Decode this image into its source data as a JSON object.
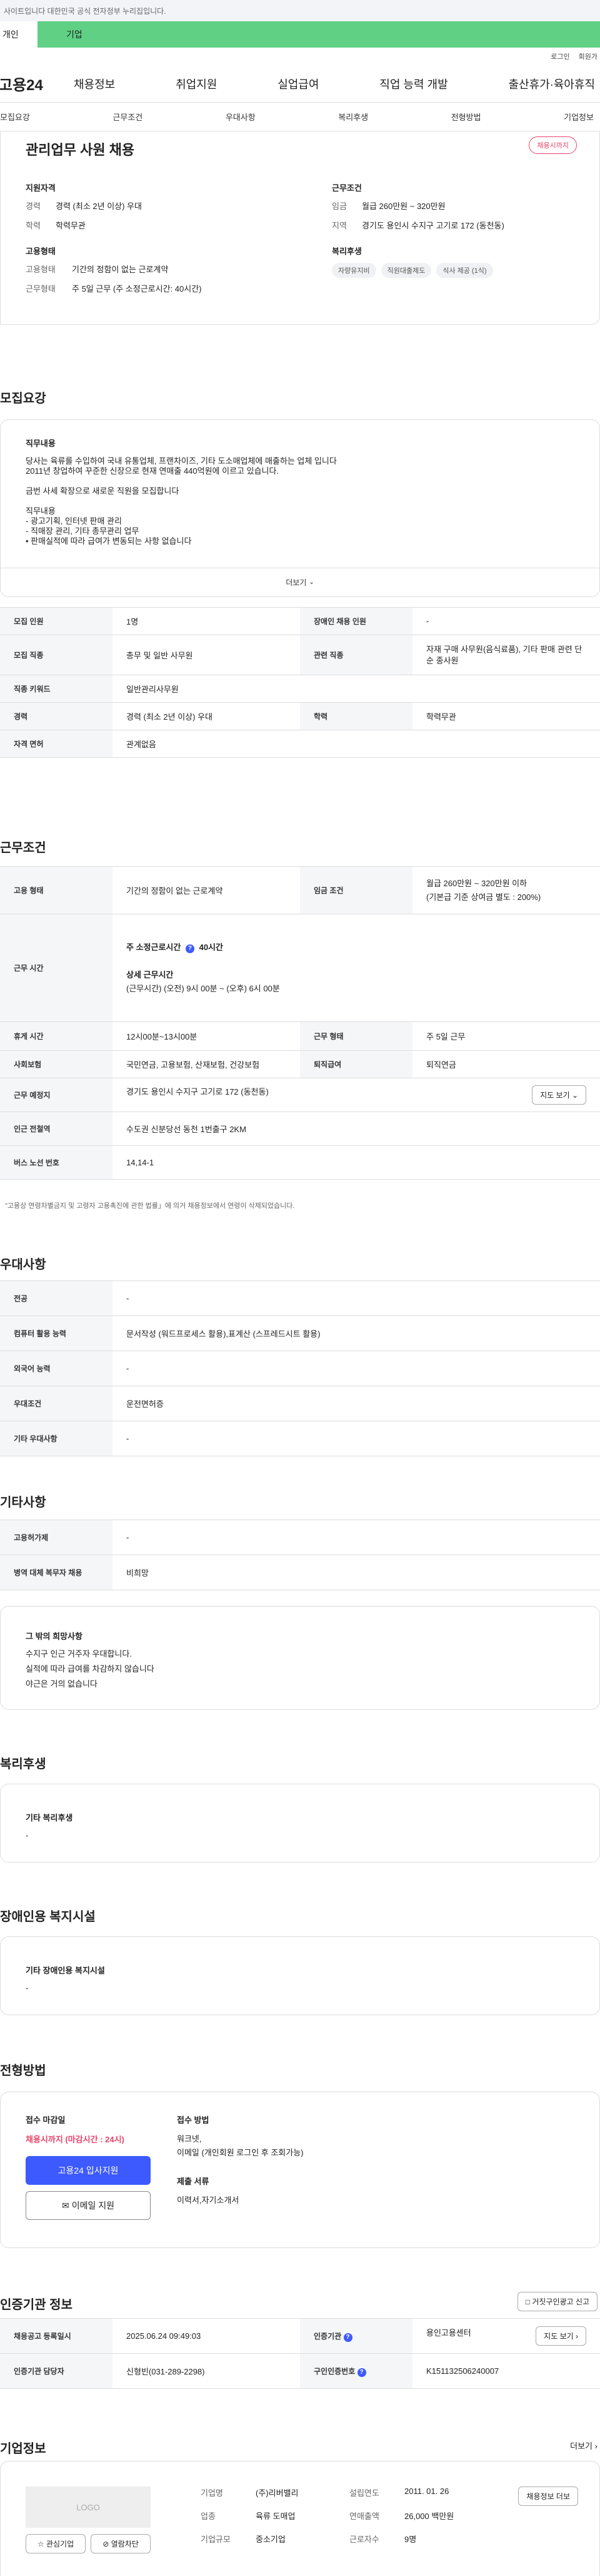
{
  "topstrip": {
    "text": "사이트입니다 대한민국 공식 전자정부 누리집입니다."
  },
  "tabs": {
    "personal": "개인",
    "biz": "기업"
  },
  "util": {
    "login": "로그인",
    "join": "회원가"
  },
  "gnb": {
    "logo": "고용24",
    "menu": [
      "채용정보",
      "취업지원",
      "실업급여",
      "직업 능력 개발",
      "출산휴가·육아휴직"
    ]
  },
  "anchor": [
    "모집요강",
    "근무조건",
    "우대사항",
    "복리후생",
    "전형방법",
    "기업정보"
  ],
  "summary": {
    "title": "관리업무 사원 채용",
    "badge": "채용시까지",
    "qual_h": "지원자격",
    "qual": [
      {
        "k": "경력",
        "v": "경력 (최소 2년 이상) 우대"
      },
      {
        "k": "학력",
        "v": "학력무관"
      }
    ],
    "emp_h": "고용형태",
    "emp": [
      {
        "k": "고용형태",
        "v": "기간의 정함이 없는 근로계약"
      },
      {
        "k": "근무형태",
        "v": "주 5일 근무 (주 소정근로시간: 40시간)"
      }
    ],
    "cond_h": "근무조건",
    "cond": [
      {
        "k": "임금",
        "v": "월급 260만원 ~ 320만원"
      },
      {
        "k": "지역",
        "v": "경기도 용인시 수지구 고기로 172 (동천동)"
      }
    ],
    "welfare_h": "복리후생",
    "chips": [
      "자량유지비",
      "직원대출제도",
      "식사 제공 (1식)"
    ]
  },
  "recruit": {
    "h": "모집요강",
    "duty_h": "직무내용",
    "duty_lines": [
      "당사는 육류를 수입하여 국내 유통업체, 프랜차이즈, 기타 도소매업체에 매출하는 업체 입니다",
      "2011년 창업하여 꾸준한 신장으로 현재 연매출 440억원에 이르고 있습니다.",
      "",
      "금번 사세 확장으로 새로운 직원을 모집합니다",
      "",
      "직무내용",
      "- 광고기획, 인터넷 판매 관리",
      "- 직매장 관리, 기타 총무관리 업무",
      "• 판매실적에 따라 급여가 변동되는 사항 없습니다"
    ],
    "more": "더보기",
    "rows": [
      {
        "k1": "모집 인원",
        "v1": "1명",
        "k2": "장애인 채용 인원",
        "v2": "-"
      },
      {
        "k1": "모집 직종",
        "v1": "총무 및 일반 사무원",
        "k2": "관련 직종",
        "v2": "자재 구매 사무원(음식료품), 기타 판매 관련 단순 종사원"
      },
      {
        "k1": "직종 키워드",
        "v1": "일반관리사무원",
        "k2": "",
        "v2": ""
      },
      {
        "k1": "경력",
        "v1": "경력 (최소 2년 이상) 우대",
        "k2": "학력",
        "v2": "학력무관"
      },
      {
        "k1": "자격 면허",
        "v1": "관계없음",
        "k2": "",
        "v2": ""
      }
    ]
  },
  "work": {
    "h": "근무조건",
    "emp_k": "고용 형태",
    "emp_v": "기간의 정함이 없는 근로계약",
    "wage_k": "임금 조건",
    "wage_v1": "월급 260만원 ~ 320만원 이하",
    "wage_v2": "(기본급 기준 상여금 별도 : 200%)",
    "time_k": "근무 시간",
    "time_h1": "주 소정근로시간",
    "time_v1": "40시간",
    "time_h2": "상세 근무시간",
    "time_v2": "(근무시간) (오전) 9시 00분 ~ (오후) 6시 00분",
    "rest_k": "휴게 시간",
    "rest_v": "12시00분~13시00분",
    "form_k": "근무 형태",
    "form_v": "주 5일 근무",
    "ins_k": "사회보험",
    "ins_v": "국민연금, 고용보험, 산재보험, 건강보험",
    "ret_k": "퇴직급여",
    "ret_v": "퇴직연금",
    "place_k": "근무 예정지",
    "place_v": "경기도 용인시 수지구 고기로 172 (동천동)",
    "map_btn": "지도 보기",
    "sub_k": "인근 전철역",
    "sub_v": "수도권 신분당선 동천 1번출구 2KM",
    "bus_k": "버스 노선 번호",
    "bus_v": "14,14-1",
    "note": "\"고용상 연령차별금지 및 고령자 고용촉진에 관한 법률」에 의거 채용정보에서 연령이 삭제되었습니다."
  },
  "pref": {
    "h": "우대사항",
    "rows": [
      {
        "k": "전공",
        "v": "-"
      },
      {
        "k": "컴퓨터 활용 능력",
        "v": "문서작성 (워드프로세스 활용),표계산 (스프레드시트 활용)"
      },
      {
        "k": "외국어 능력",
        "v": "-"
      },
      {
        "k": "우대조건",
        "v": "운전면허증"
      },
      {
        "k": "기타 우대사항",
        "v": "-"
      }
    ]
  },
  "etc": {
    "h": "기타사항",
    "rows": [
      {
        "k": "고용허가제",
        "v": "-"
      },
      {
        "k": "병역 대체 복무자 채용",
        "v": "비희망"
      }
    ],
    "box_h": "그 밖의 희망사항",
    "box_lines": [
      "수지구 인근 거주자 우대합니다.",
      "실적에 따라 급여를 차감하지 않습니다",
      "야근은 거의 없습니다"
    ]
  },
  "welfare": {
    "h": "복리후생",
    "box_h": "기타 복리후생",
    "box_v": "-"
  },
  "disab": {
    "h": "장애인용 복지시설",
    "box_h": "기타 장애인용 복지시설",
    "box_v": "-"
  },
  "select": {
    "h": "전형방법",
    "dl_h": "접수 마감일",
    "dl_v": "채용시까지 (마감시간 : 24시)",
    "apply_btn": "고용24 입사지원",
    "email_btn": "이메일 지원",
    "method_h": "접수 방법",
    "method_v1": "워크넷,",
    "method_v2": "이메일 (개인회원 로그인 후 조회가능)",
    "docs_h": "제출 서류",
    "docs_v": "이력서,자기소개서"
  },
  "agency": {
    "h": "인증기관 정보",
    "report_btn": "거짓구인광고 신고",
    "reg_k": "채용공고 등록일시",
    "reg_v": "2025.06.24 09:49:03",
    "org_k": "인증기관",
    "org_v": "용인고용센터",
    "map_btn": "지도 보기",
    "mgr_k": "인증기관 담당자",
    "mgr_v": "신형빈(031-289-2298)",
    "no_k": "구인인증번호",
    "no_v": "K151132506240007"
  },
  "company": {
    "h": "기업정보",
    "more": "더보기",
    "logo": "LOGO",
    "fav_btn": "관심기업",
    "block_btn": "열람차단",
    "name_k": "기업명",
    "name_v": "(주)리버밸리",
    "year_k": "설립연도",
    "year_v": "2011. 01. 26",
    "biz_k": "업종",
    "biz_v": "육류 도매업",
    "sales_k": "연매출액",
    "sales_v": "26,000 백만원",
    "size_k": "기업규모",
    "size_v": "중소기업",
    "emp_k": "근로자수",
    "emp_v": "9명",
    "jobs_btn": "채용정보 더보"
  }
}
